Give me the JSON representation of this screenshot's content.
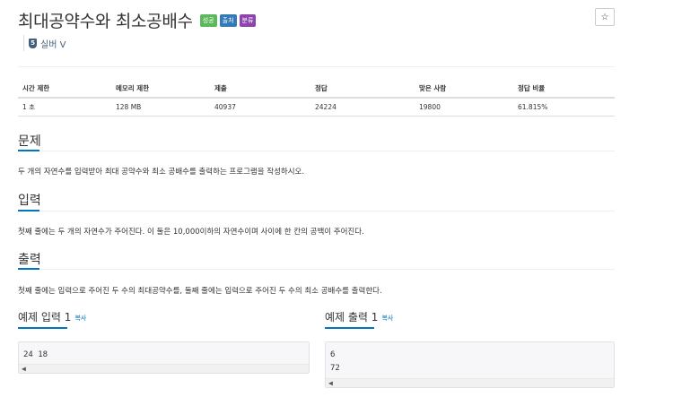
{
  "problem": {
    "title": "최대공약수와 최소공배수",
    "labels": [
      {
        "text": "성공",
        "color": "#5cb85c"
      },
      {
        "text": "출처",
        "color": "#337ab7"
      },
      {
        "text": "분류",
        "color": "#8e44ad"
      }
    ],
    "star": "☆",
    "tier": {
      "badge": "5",
      "name": "실버 V",
      "color": "#435f7a"
    }
  },
  "info_table": {
    "headers": [
      "시간 제한",
      "메모리 제한",
      "제출",
      "정답",
      "맞은 사람",
      "정답 비율"
    ],
    "row": [
      "1 초",
      "128 MB",
      "40937",
      "24224",
      "19800",
      "61.815%"
    ]
  },
  "sections": {
    "problem": {
      "title": "문제",
      "text": "두 개의 자연수를 입력받아 최대 공약수와 최소 공배수를 출력하는 프로그램을 작성하시오."
    },
    "input": {
      "title": "입력",
      "text": "첫째 줄에는 두 개의 자연수가 주어진다. 이 둘은 10,000이하의 자연수이며 사이에 한 칸의 공백이 주어진다."
    },
    "output": {
      "title": "출력",
      "text": "첫째 줄에는 입력으로 주어진 두 수의 최대공약수를, 둘째 줄에는 입력으로 주어진 두 수의 최소 공배수를 출력한다."
    }
  },
  "samples": {
    "input": {
      "title": "예제 입력 1",
      "copy": "복사",
      "lines": [
        "24 18"
      ]
    },
    "output": {
      "title": "예제 출력 1",
      "copy": "복사",
      "lines": [
        "6",
        "72"
      ]
    }
  }
}
